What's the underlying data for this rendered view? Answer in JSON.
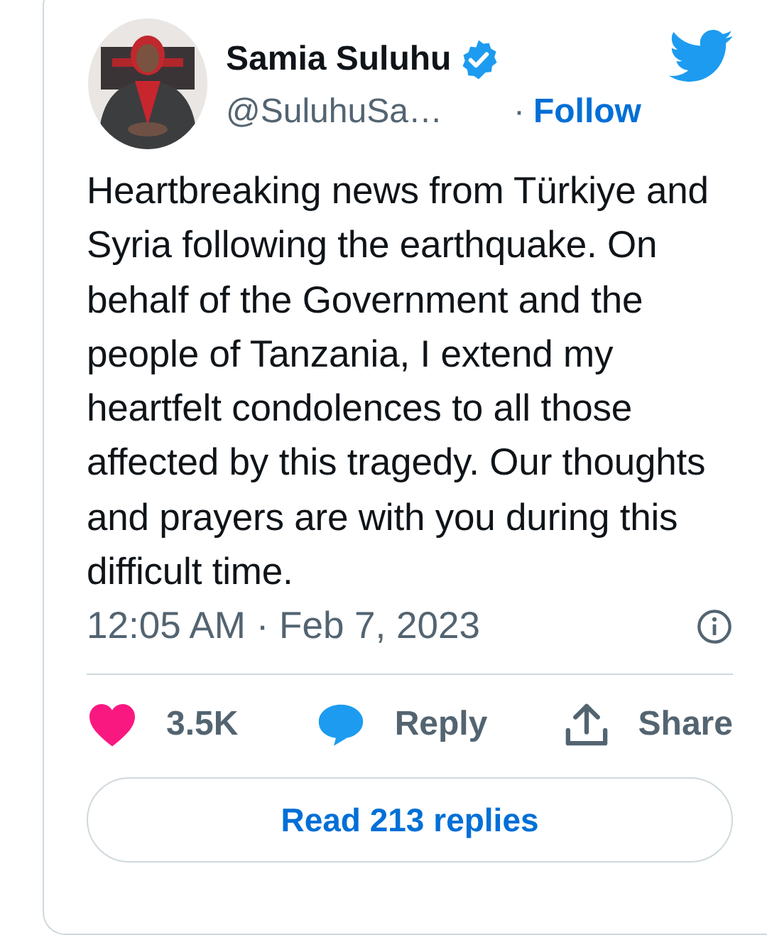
{
  "author": {
    "name": "Samia Suluhu",
    "verified": true,
    "handle": "@SuluhuSa…",
    "separator": "·",
    "follow": "Follow"
  },
  "text": "Heartbreaking news from Türkiye and Syria following the earthquake. On behalf of the Government and the people of Tanzania, I extend my heartfelt condolences to all those affected by this tragedy. Our thoughts and prayers are with you during this difficult time.",
  "timestamp": "12:05 AM · Feb 7, 2023",
  "actions": [
    {
      "kind": "like",
      "label": "3.5K"
    },
    {
      "kind": "reply",
      "label": "Reply"
    },
    {
      "kind": "share",
      "label": "Share"
    }
  ],
  "read_replies": "Read 213 replies"
}
